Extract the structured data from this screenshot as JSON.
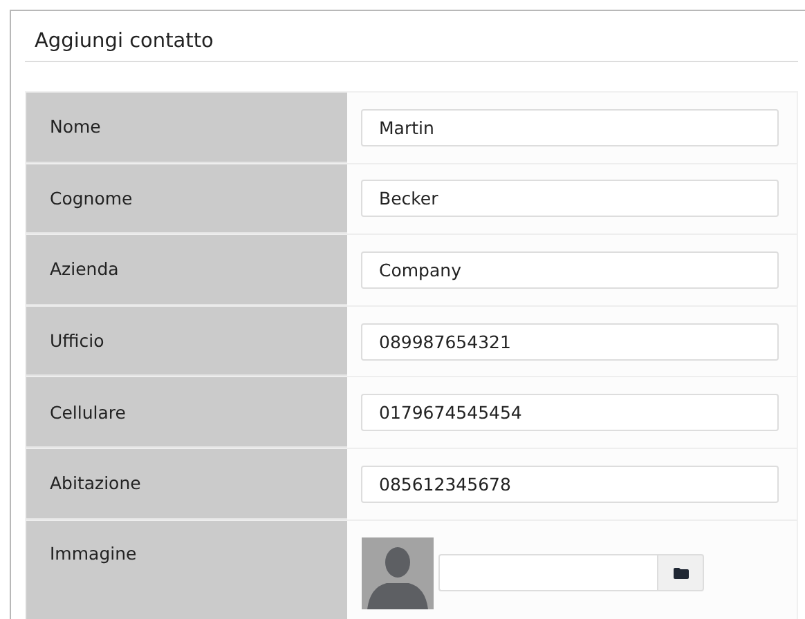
{
  "title": "Aggiungi contatto",
  "fields": [
    {
      "kind": "text",
      "label": "Nome",
      "value": "Martin"
    },
    {
      "kind": "text",
      "label": "Cognome",
      "value": "Becker"
    },
    {
      "kind": "text",
      "label": "Azienda",
      "value": "Company"
    },
    {
      "kind": "text",
      "label": "Ufficio",
      "value": "089987654321"
    },
    {
      "kind": "text",
      "label": "Cellulare",
      "value": "0179674545454"
    },
    {
      "kind": "text",
      "label": "Abitazione",
      "value": "085612345678"
    },
    {
      "kind": "image",
      "label": "Immagine"
    }
  ]
}
